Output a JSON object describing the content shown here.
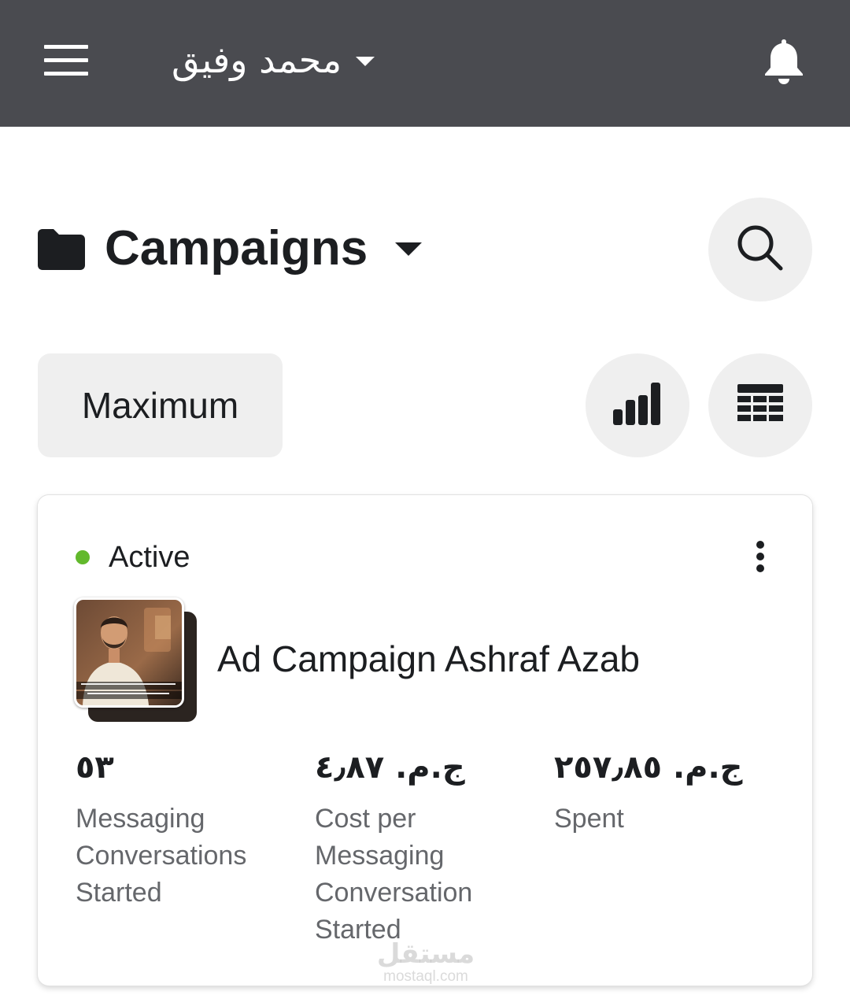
{
  "topbar": {
    "account_name": "محمد وفيق",
    "icons": {
      "menu": "hamburger-icon",
      "account_caret": "chevron-down-icon",
      "notifications": "bell-icon"
    }
  },
  "header": {
    "title": "Campaigns",
    "icons": {
      "folder": "folder-icon",
      "title_caret": "chevron-down-icon",
      "search": "search-icon"
    }
  },
  "toolbar": {
    "date_range_label": "Maximum",
    "icons": {
      "chart": "bar-chart-icon",
      "columns": "table-icon"
    }
  },
  "campaign": {
    "status": "Active",
    "status_color": "#62b92c",
    "name": "Ad Campaign Ashraf Azab",
    "metrics": [
      {
        "value": "٥٣",
        "label": "Messaging Conversations Started"
      },
      {
        "value": "ج.م. ٤٫٨٧",
        "label": "Cost per Messaging Conversation Started"
      },
      {
        "value": "ج.م. ٢٥٧٫٨٥",
        "label": "Spent"
      }
    ]
  },
  "watermark": {
    "arabic": "مستقل",
    "latin": "mostaql.com"
  },
  "colors": {
    "topbar_bg": "#4a4b50",
    "button_bg": "#efefef",
    "text": "#1c1e21",
    "muted": "#65676b"
  }
}
